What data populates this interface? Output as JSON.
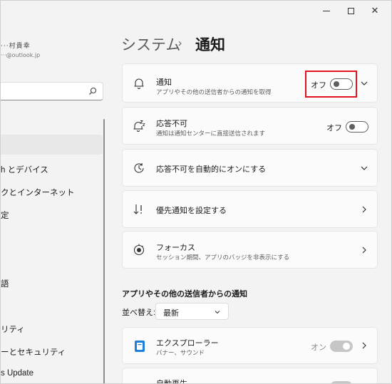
{
  "window_controls": {
    "minimize": "minimize",
    "maximize": "maximize",
    "close": "✕"
  },
  "account": {
    "name": "···村貴幸",
    "email": "···@outlook.jp"
  },
  "search": {
    "placeholder": ""
  },
  "nav": {
    "items": [
      {
        "label": "h とデバイス"
      },
      {
        "label": "クとインターネット"
      },
      {
        "label": "定"
      },
      {
        "label": "語"
      },
      {
        "label": "リティ"
      },
      {
        "label": "ーとセキュリティ"
      },
      {
        "label": "s Update"
      }
    ]
  },
  "breadcrumb": {
    "parent": "システム",
    "separator": "›",
    "current": "通知"
  },
  "cards": {
    "notifications": {
      "title": "通知",
      "subtitle": "アプリやその他の送信者からの通知を取得",
      "state": "オフ"
    },
    "dnd": {
      "title": "応答不可",
      "subtitle": "通知は通知センターに直接送信されます",
      "state": "オフ"
    },
    "dnd_auto": {
      "title": "応答不可を自動的にオンにする"
    },
    "priority": {
      "title": "優先通知を設定する"
    },
    "focus": {
      "title": "フォーカス",
      "subtitle": "セッション期間、アプリのバッジを非表示にする"
    }
  },
  "senders": {
    "title": "アプリやその他の送信者からの通知",
    "sort_label": "並べ替え:",
    "sort_value": "最新",
    "apps": [
      {
        "name": "エクスプローラー",
        "subtitle": "バナー、サウンド",
        "state": "オン"
      },
      {
        "name": "自動再生"
      }
    ]
  },
  "colors": {
    "accent_highlight": "#e0141e",
    "background": "#f3f3f3",
    "card": "#fbfbfb",
    "explorer_icon": "#1e7fd8"
  }
}
